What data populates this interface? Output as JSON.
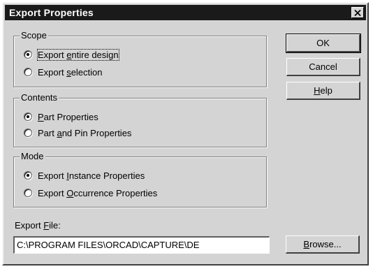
{
  "window": {
    "title": "Export Properties"
  },
  "scope": {
    "label": "Scope",
    "options": [
      {
        "pre": "Export ",
        "key": "e",
        "post": "ntire design",
        "selected": true
      },
      {
        "pre": "Export ",
        "key": "s",
        "post": "election",
        "selected": false
      }
    ]
  },
  "contents": {
    "label": "Contents",
    "options": [
      {
        "pre": "",
        "key": "P",
        "post": "art Properties",
        "selected": true
      },
      {
        "pre": "Part ",
        "key": "a",
        "post": "nd Pin Properties",
        "selected": false
      }
    ]
  },
  "mode": {
    "label": "Mode",
    "options": [
      {
        "pre": "Export ",
        "key": "I",
        "post": "nstance Properties",
        "selected": true
      },
      {
        "pre": "Export ",
        "key": "O",
        "post": "ccurrence Properties",
        "selected": false
      }
    ]
  },
  "buttons": {
    "ok": "OK",
    "cancel": "Cancel",
    "help": {
      "key": "H",
      "post": "elp"
    },
    "browse": {
      "key": "B",
      "post": "rowse..."
    }
  },
  "export_file": {
    "label": {
      "pre": "Export ",
      "key": "F",
      "post": "ile:"
    },
    "value": "C:\\PROGRAM FILES\\ORCAD\\CAPTURE\\DE"
  }
}
